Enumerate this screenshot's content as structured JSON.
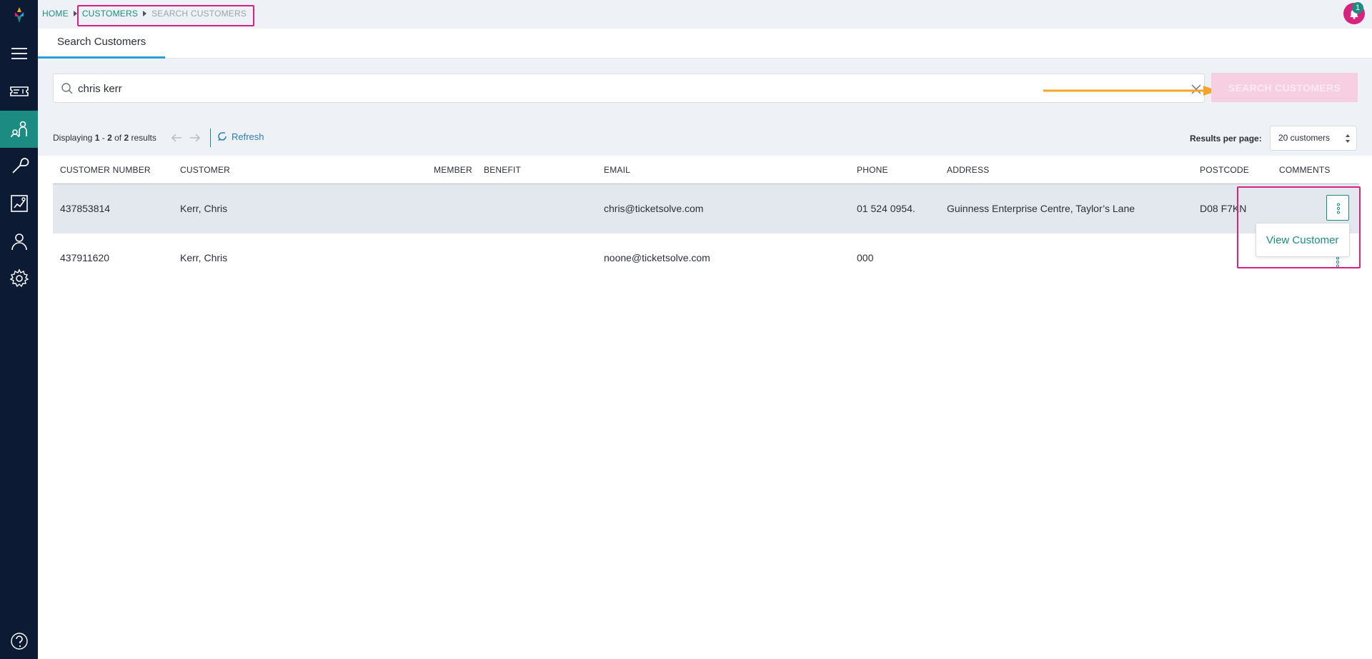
{
  "breadcrumb": {
    "home": "HOME",
    "customers": "CUSTOMERS",
    "current": "SEARCH CUSTOMERS"
  },
  "notifications": {
    "count": "1"
  },
  "sidebar": {
    "items": [
      {
        "icon": "logo-icon"
      },
      {
        "icon": "menu-icon"
      },
      {
        "icon": "ticket-icon"
      },
      {
        "icon": "customers-icon",
        "active": true
      },
      {
        "icon": "tools-icon"
      },
      {
        "icon": "reports-icon"
      },
      {
        "icon": "user-icon"
      },
      {
        "icon": "settings-icon"
      },
      {
        "icon": "help-icon"
      }
    ]
  },
  "tabs": [
    {
      "label": "Search Customers",
      "active": true
    }
  ],
  "search": {
    "value": "chris kerr",
    "button_label": "SEARCH CUSTOMERS"
  },
  "results": {
    "prefix": "Displaying",
    "from": "1",
    "to": "2",
    "total": "2",
    "suffix": "results",
    "refresh_label": "Refresh",
    "per_page_label": "Results per page:",
    "per_page_value": "20 customers"
  },
  "table": {
    "columns": [
      "CUSTOMER NUMBER",
      "CUSTOMER",
      "MEMBER",
      "BENEFIT",
      "EMAIL",
      "PHONE",
      "ADDRESS",
      "POSTCODE",
      "COMMENTS"
    ],
    "rows": [
      {
        "number": "437853814",
        "customer": "Kerr, Chris",
        "member": "",
        "benefit": "",
        "email": "chris@ticketsolve.com",
        "phone": "01 524 0954.",
        "address": "Guinness Enterprise Centre, Taylor’s Lane",
        "postcode": "D08 F7KN",
        "comments": ""
      },
      {
        "number": "437911620",
        "customer": "Kerr, Chris",
        "member": "",
        "benefit": "",
        "email": "noone@ticketsolve.com",
        "phone": "000",
        "address": "",
        "postcode": "",
        "comments": ""
      }
    ]
  },
  "row_menu": {
    "view_label": "View Customer"
  },
  "colors": {
    "sidebar": "#0c1a33",
    "accent_teal": "#1c8c82",
    "highlight_pink": "#d6247e",
    "button_disabled": "#f7cfe2",
    "arrow_orange": "#f4a52a"
  }
}
